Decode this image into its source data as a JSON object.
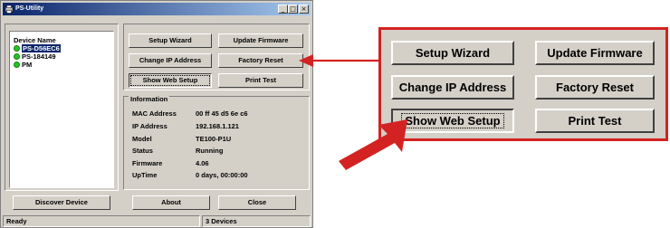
{
  "window": {
    "title": "PS-Utility",
    "controls": {
      "minimize": "_",
      "maximize": "□",
      "close": "×"
    }
  },
  "device_list": {
    "header": "Device Name",
    "items": [
      {
        "label": "PS-D56EC6",
        "selected": true
      },
      {
        "label": "PS-184149",
        "selected": false
      },
      {
        "label": "PM",
        "selected": false
      }
    ],
    "status_dot_color": "#29c229"
  },
  "buttons": {
    "setup_wizard": "Setup Wizard",
    "update_firmware": "Update Firmware",
    "change_ip": "Change IP Address",
    "factory_reset": "Factory Reset",
    "show_web_setup": "Show Web Setup",
    "print_test": "Print Test",
    "discover_device": "Discover Device",
    "about": "About",
    "close": "Close"
  },
  "information": {
    "title": "Information",
    "rows": [
      {
        "label": "MAC Address",
        "value": "00 ff 45 d5 6e c6"
      },
      {
        "label": "IP Address",
        "value": "192.168.1.121"
      },
      {
        "label": "Model",
        "value": "TE100-P1U"
      },
      {
        "label": "Status",
        "value": "Running"
      },
      {
        "label": "Firmware",
        "value": "4.06"
      },
      {
        "label": "UpTime",
        "value": "0 days, 00:00:00"
      }
    ]
  },
  "statusbar": {
    "left": "Ready",
    "right": "3 Devices"
  },
  "callout": {
    "setup_wizard": "Setup Wizard",
    "update_firmware": "Update Firmware",
    "change_ip": "Change IP Address",
    "factory_reset": "Factory Reset",
    "show_web_setup": "Show Web Setup",
    "print_test": "Print Test",
    "highlight_color": "#d32222"
  }
}
